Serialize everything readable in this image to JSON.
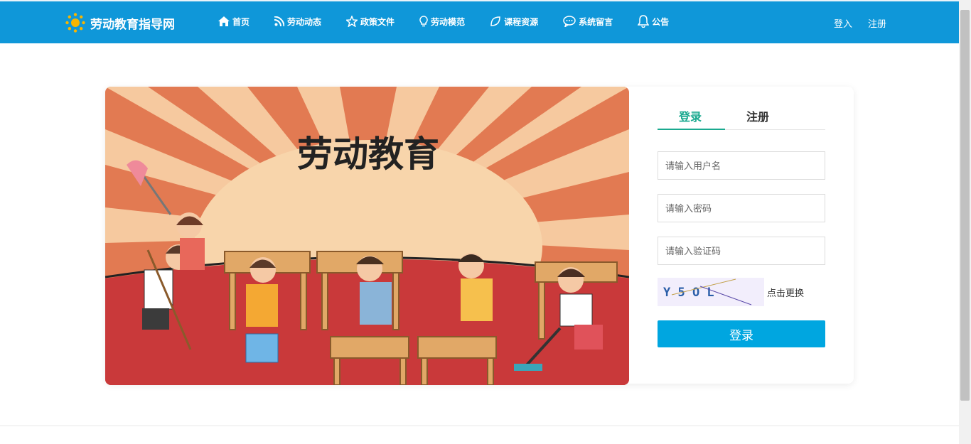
{
  "header": {
    "site_title": "劳动教育指导网",
    "nav": [
      {
        "label": "首页",
        "icon": "home-icon"
      },
      {
        "label": "劳动动态",
        "icon": "rss-icon"
      },
      {
        "label": "政策文件",
        "icon": "star-icon"
      },
      {
        "label": "劳动模范",
        "icon": "lightbulb-icon"
      },
      {
        "label": "课程资源",
        "icon": "leaf-icon"
      },
      {
        "label": "系统留言",
        "icon": "chat-icon"
      },
      {
        "label": "公告",
        "icon": "bell-icon"
      }
    ],
    "login_link": "登入",
    "register_link": "注册"
  },
  "banner": {
    "title": "劳动教育"
  },
  "auth_panel": {
    "tab_login": "登录",
    "tab_register": "注册",
    "username_placeholder": "请输入用户名",
    "password_placeholder": "请输入密码",
    "captcha_placeholder": "请输入验证码",
    "captcha_text": "Y 5 O L",
    "captcha_refresh": "点击更换",
    "login_button": "登录"
  },
  "colors": {
    "header_bg": "#0f97d9",
    "accent_tab": "#1aa98f",
    "button_bg": "#00a6e0"
  }
}
